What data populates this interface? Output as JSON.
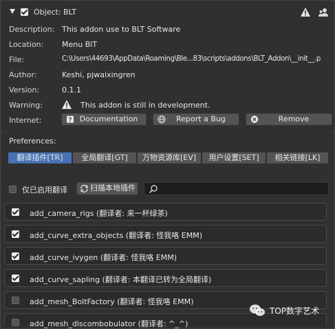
{
  "addon": {
    "title": "Object: BLT",
    "rows": [
      {
        "label": "Description:",
        "value": "This addon use to BLT Software"
      },
      {
        "label": "Location:",
        "value": "Menu BlT"
      },
      {
        "label": "File:",
        "value": "C:\\Users\\44693\\AppData\\Roaming\\Ble...83\\scripts\\addons\\BLT_Addon\\__init__.p"
      },
      {
        "label": "Author:",
        "value": "Keshi, pjwaixingren"
      },
      {
        "label": "Version:",
        "value": "0.1.1"
      }
    ],
    "warning_label": "Warning:",
    "warning_value": "This addon is still in development.",
    "internet_label": "Internet:",
    "buttons": {
      "documentation": "Documentation",
      "report_bug": "Report a Bug",
      "remove": "Remove"
    }
  },
  "preferences": {
    "label": "Preferences:",
    "tabs": [
      "翻译插件[TR]",
      "全局翻译[GT]",
      "万物资源库[EV]",
      "用户设置[SET]",
      "相关链接[LK]"
    ],
    "only_enabled_label": "仅已启用翻译",
    "scan_button": "扫描本地插件",
    "search_placeholder": ""
  },
  "items": [
    {
      "label": "add_camera_rigs (翻译者: 来一杯绿茶)",
      "checked": true
    },
    {
      "label": "add_curve_extra_objects (翻译者: 怪我咯 EMM)",
      "checked": true
    },
    {
      "label": "add_curve_ivygen (翻译者: 怪我咯 EMM)",
      "checked": true
    },
    {
      "label": "add_curve_sapling (翻译者: 本翻译已转为全局翻译)",
      "checked": true
    },
    {
      "label": "add_mesh_BoltFactory (翻译者: 怪我咯 EMM)",
      "checked": false
    },
    {
      "label": "add_mesh_discombobulator (翻译者: ^_^)",
      "checked": false
    }
  ],
  "watermark": "TOP数字艺术"
}
